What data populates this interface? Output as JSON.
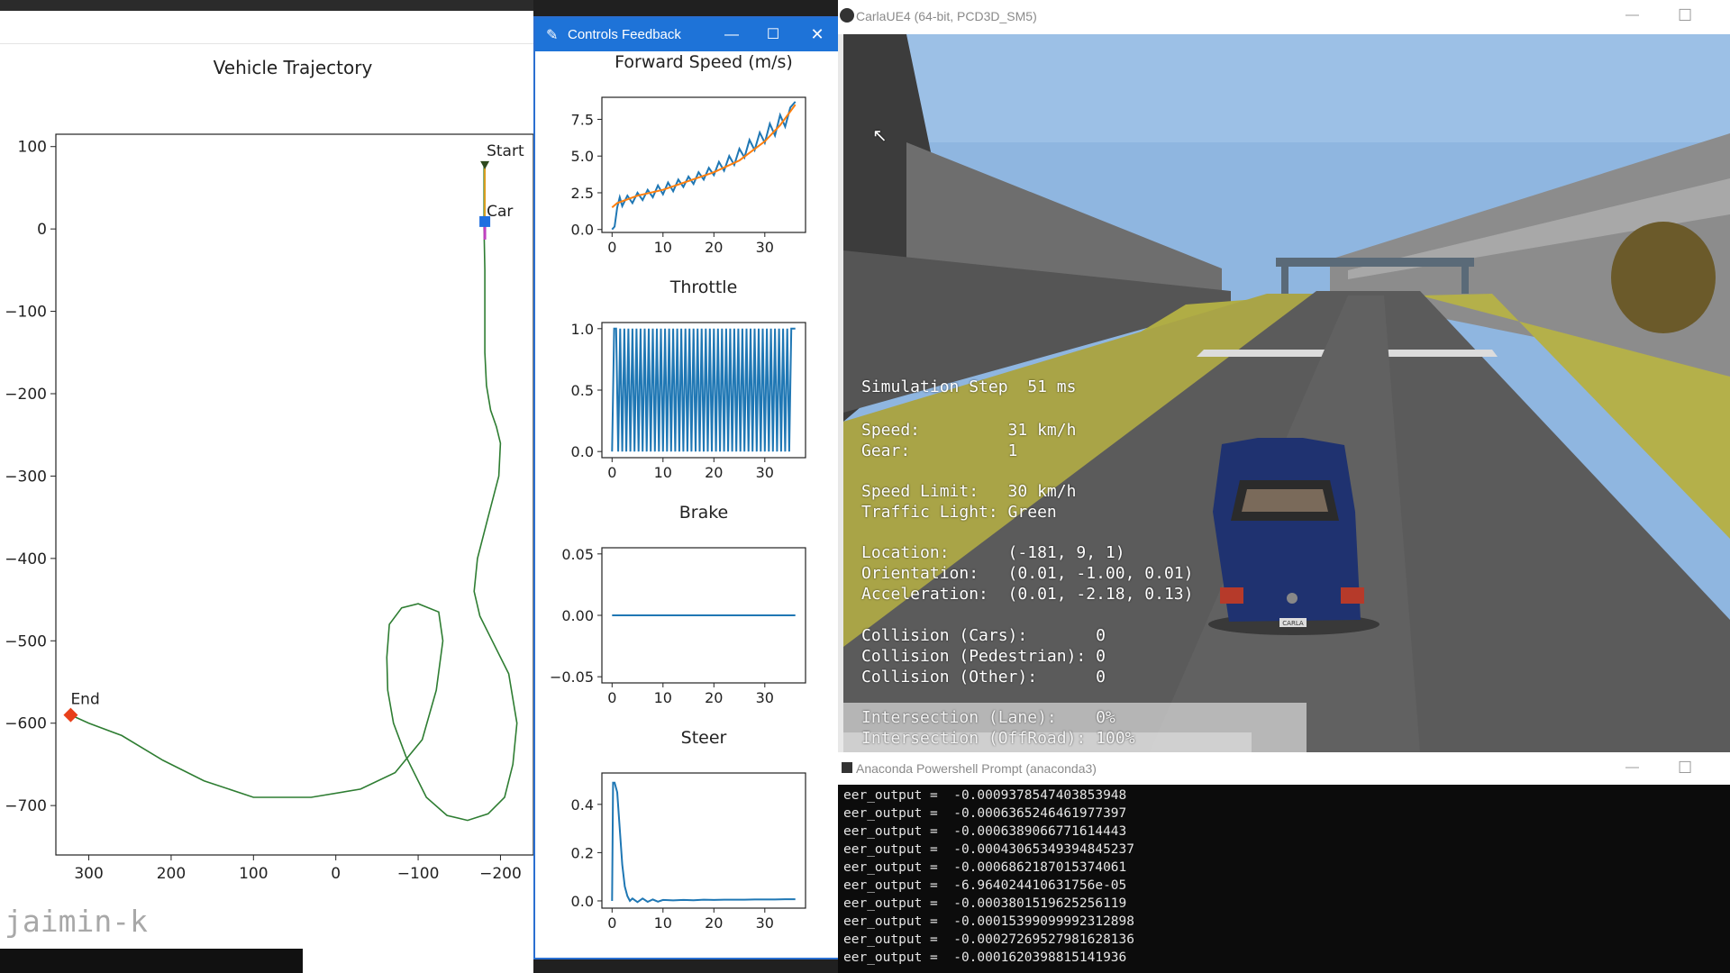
{
  "trajectory_window": {
    "title": "Vehicle Trajectory",
    "labels": {
      "start": "Start",
      "car": "Car",
      "end": "End"
    },
    "watermark": "jaimin-k",
    "chart_data": {
      "type": "line",
      "title": "Vehicle Trajectory",
      "xlabel": "",
      "ylabel": "",
      "xlim": [
        340,
        -240
      ],
      "ylim": [
        -760,
        115
      ],
      "x_ticks": [
        "300",
        "200",
        "100",
        "0",
        "−100",
        "−200"
      ],
      "y_ticks": [
        "100",
        "0",
        "−100",
        "−200",
        "−300",
        "−400",
        "−500",
        "−600",
        "−700"
      ],
      "series": [
        {
          "x": [
            -180,
            -180,
            -181,
            -181,
            -181,
            -183,
            -188,
            -195,
            -200,
            -198,
            -185,
            -172,
            -168,
            -175,
            -190,
            -210,
            -220,
            -215,
            -205,
            -185,
            -160,
            -135,
            -110,
            -85,
            -70,
            -63,
            -62,
            -65,
            -80,
            -100,
            -125,
            -130,
            -122,
            -105,
            -72,
            -30,
            30,
            100,
            160,
            210,
            260,
            300,
            322
          ],
          "y": [
            78,
            0,
            -50,
            -100,
            -150,
            -190,
            -220,
            -240,
            -260,
            -300,
            -350,
            -400,
            -440,
            -470,
            -500,
            -540,
            -600,
            -650,
            -690,
            -710,
            -718,
            -712,
            -690,
            -640,
            -600,
            -560,
            -520,
            -480,
            -460,
            -455,
            -465,
            -500,
            -560,
            -620,
            -660,
            -680,
            -690,
            -690,
            -670,
            -645,
            -615,
            -600,
            -590
          ]
        }
      ],
      "markers": {
        "start": [
          -181,
          78
        ],
        "car": [
          -181,
          9
        ],
        "end": [
          322,
          -590
        ]
      }
    }
  },
  "controls_window": {
    "title": "Controls Feedback",
    "buttons": {
      "minimize": "—",
      "maximize": "☐",
      "close": "✕"
    },
    "chart_data": [
      {
        "type": "line",
        "title": "Forward Speed (m/s)",
        "ylim": [
          -0.2,
          9.0
        ],
        "xlim": [
          -2,
          38
        ],
        "x_ticks": [
          "0",
          "10",
          "20",
          "30"
        ],
        "y_ticks": [
          "7.5",
          "5.0",
          "2.5",
          "0.0"
        ],
        "series": [
          {
            "color": "#1f77b4",
            "x": [
              0,
              0.5,
              1,
              1.5,
              2,
              3,
              4,
              5,
              6,
              7,
              8,
              9,
              10,
              11,
              12,
              13,
              14,
              15,
              16,
              17,
              18,
              19,
              20,
              21,
              22,
              23,
              24,
              25,
              26,
              27,
              28,
              29,
              30,
              31,
              32,
              33,
              34,
              35,
              36
            ],
            "y": [
              0,
              0.2,
              1.5,
              2.2,
              1.6,
              2.3,
              1.8,
              2.5,
              2.0,
              2.7,
              2.2,
              3.0,
              2.4,
              3.2,
              2.6,
              3.4,
              2.9,
              3.6,
              3.1,
              3.9,
              3.4,
              4.2,
              3.7,
              4.6,
              4.0,
              5.0,
              4.4,
              5.5,
              4.9,
              6.1,
              5.4,
              6.6,
              5.9,
              7.2,
              6.4,
              7.8,
              7.0,
              8.3,
              8.7
            ]
          },
          {
            "color": "#ff7f0e",
            "x": [
              0,
              1,
              5,
              10,
              15,
              20,
              25,
              30,
              33,
              36
            ],
            "y": [
              1.5,
              1.8,
              2.3,
              2.7,
              3.3,
              3.9,
              4.7,
              6.0,
              7.1,
              8.5
            ]
          }
        ]
      },
      {
        "type": "line",
        "title": "Throttle",
        "ylim": [
          -0.05,
          1.05
        ],
        "xlim": [
          -2,
          38
        ],
        "x_ticks": [
          "0",
          "10",
          "20",
          "30"
        ],
        "y_ticks": [
          "1.0",
          "0.5",
          "0.0"
        ],
        "series": [
          {
            "color": "#1f77b4",
            "x": [
              0,
              0.4,
              0.8,
              1.2,
              1.6,
              2.0,
              2.4,
              2.8,
              3.2,
              3.6,
              4.0,
              4.4,
              4.8,
              5.2,
              5.6,
              6.0,
              6.4,
              6.8,
              7.2,
              7.6,
              8.0,
              8.4,
              8.8,
              9.2,
              9.6,
              10.0,
              10.4,
              10.8,
              11.2,
              11.6,
              12.0,
              12.4,
              12.8,
              13.2,
              13.6,
              14.0,
              14.4,
              14.8,
              15.2,
              15.6,
              16.0,
              16.4,
              16.8,
              17.2,
              17.6,
              18.0,
              18.4,
              18.8,
              19.2,
              19.6,
              20.0,
              20.4,
              20.8,
              21.2,
              21.6,
              22.0,
              22.4,
              22.8,
              23.2,
              23.6,
              24.0,
              24.4,
              24.8,
              25.2,
              25.6,
              26.0,
              26.4,
              26.8,
              27.2,
              27.6,
              28.0,
              28.4,
              28.8,
              29.2,
              29.6,
              30.0,
              30.4,
              30.8,
              31.2,
              31.6,
              32.0,
              32.4,
              32.8,
              33.2,
              33.6,
              34.0,
              34.4,
              34.8,
              35.2,
              35.6,
              36.0
            ],
            "y": [
              0,
              1,
              1,
              0,
              1,
              0,
              1,
              0,
              1,
              0,
              1,
              0,
              1,
              0,
              1,
              0,
              1,
              0,
              1,
              0,
              1,
              0,
              1,
              0,
              1,
              0,
              1,
              0,
              1,
              0,
              1,
              0,
              1,
              0,
              1,
              0,
              1,
              0,
              1,
              0,
              1,
              0,
              1,
              0,
              1,
              0,
              1,
              0,
              1,
              0,
              1,
              0,
              1,
              0,
              1,
              0,
              1,
              0,
              1,
              0,
              1,
              0,
              1,
              0,
              1,
              0,
              1,
              0,
              1,
              0,
              1,
              0,
              1,
              0,
              1,
              0,
              1,
              0,
              1,
              0,
              1,
              0,
              1,
              0,
              1,
              0,
              1,
              0,
              1,
              1,
              1
            ]
          }
        ]
      },
      {
        "type": "line",
        "title": "Brake",
        "ylim": [
          -0.055,
          0.055
        ],
        "xlim": [
          -2,
          38
        ],
        "x_ticks": [
          "0",
          "10",
          "20",
          "30"
        ],
        "y_ticks": [
          "0.05",
          "0.00",
          "−0.05"
        ],
        "series": [
          {
            "color": "#1f77b4",
            "x": [
              0,
              36
            ],
            "y": [
              0,
              0
            ]
          }
        ]
      },
      {
        "type": "line",
        "title": "Steer",
        "ylim": [
          -0.03,
          0.53
        ],
        "xlim": [
          -2,
          38
        ],
        "x_ticks": [
          "0",
          "10",
          "20",
          "30"
        ],
        "y_ticks": [
          "0.4",
          "0.2",
          "0.0"
        ],
        "series": [
          {
            "color": "#1f77b4",
            "x": [
              0,
              0.2,
              0.5,
              1,
              1.5,
              2,
              2.5,
              3,
              3.5,
              4,
              5,
              6,
              7,
              8,
              9,
              10,
              12,
              14,
              16,
              18,
              20,
              22,
              24,
              26,
              28,
              30,
              32,
              34,
              36
            ],
            "y": [
              0,
              0.49,
              0.49,
              0.45,
              0.3,
              0.15,
              0.06,
              0.02,
              0.0,
              0.01,
              -0.005,
              0.01,
              -0.004,
              0.006,
              -0.003,
              0.004,
              0.002,
              0.004,
              0.003,
              0.005,
              0.004,
              0.005,
              0.005,
              0.005,
              0.006,
              0.006,
              0.006,
              0.007,
              0.007
            ]
          }
        ]
      }
    ]
  },
  "carla_window": {
    "title": "CarlaUE4 (64-bit, PCD3D_SM5)",
    "buttons": {
      "minimize": "—",
      "maximize": "☐"
    },
    "hud": {
      "simulation_step": "Simulation Step  51 ms",
      "speed": "Speed:         31 km/h",
      "gear": "Gear:          1",
      "speed_limit": "Speed Limit:   30 km/h",
      "traffic_light": "Traffic Light: Green",
      "location": "Location:      (-181, 9, 1)",
      "orientation": "Orientation:   (0.01, -1.00, 0.01)",
      "acceleration": "Acceleration:  (0.01, -2.18, 0.13)",
      "collision_cars": "Collision (Cars):       0",
      "collision_pedestrian": "Collision (Pedestrian): 0",
      "collision_other": "Collision (Other):      0",
      "intersection_lane": "Intersection (Lane):    0%",
      "intersection_offroad": "Intersection (OffRoad): 100%"
    },
    "plate_text": "CARLA"
  },
  "anaconda_window": {
    "title": "Anaconda Powershell Prompt (anaconda3)",
    "buttons": {
      "minimize": "—",
      "maximize": "☐"
    },
    "lines": [
      "eer_output =  -0.0009378547403853948",
      "eer_output =  -0.0006365246461977397",
      "eer_output =  -0.0006389066771614443",
      "eer_output =  -0.00043065349394845237",
      "eer_output =  -0.0006862187015374061",
      "eer_output =  -6.964024410631756e-05",
      "eer_output =  -0.0003801519625256119",
      "eer_output =  -0.00015399099992312898",
      "eer_output =  -0.00027269527981628136",
      "eer_output =  -0.0001620398815141936"
    ]
  }
}
